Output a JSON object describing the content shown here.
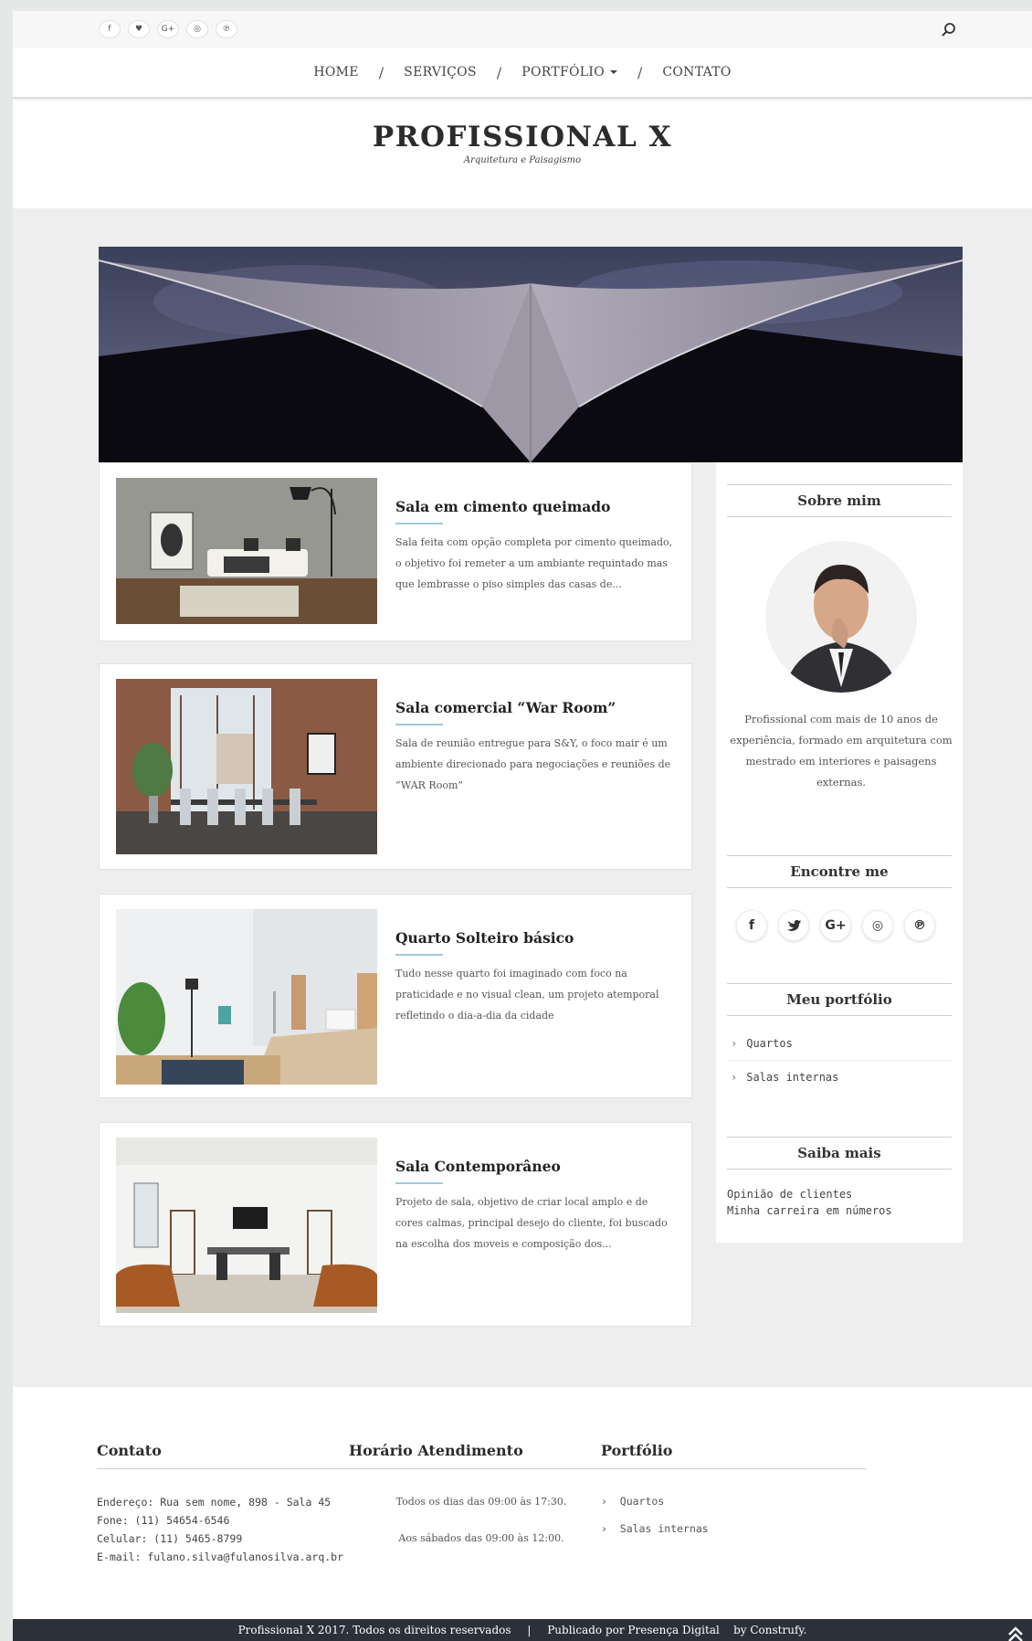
{
  "topbar": {
    "social": [
      {
        "icon": "facebook-icon",
        "glyph": "f"
      },
      {
        "icon": "twitter-icon",
        "glyph": "♥"
      },
      {
        "icon": "google-plus-icon",
        "glyph": "G+"
      },
      {
        "icon": "instagram-icon",
        "glyph": "◎"
      },
      {
        "icon": "pinterest-icon",
        "glyph": "℗"
      }
    ]
  },
  "nav": {
    "items": [
      "HOME",
      "SERVIÇOS",
      "PORTFÓLIO",
      "CONTATO"
    ],
    "separator": "/"
  },
  "brand": {
    "title": "PROFISSIONAL X",
    "tagline": "Arquitetura e Paisagismo"
  },
  "posts": [
    {
      "title": "Sala em cimento queimado",
      "excerpt": "Sala feita com opção completa por cimento queimado, o objetivo foi remeter a um ambiante requintado mas que lembrasse o piso simples das casas de..."
    },
    {
      "title": "Sala comercial “War Room”",
      "excerpt": "Sala de reunião entregue para S&Y, o foco mair é um ambiente direcionado para negociações e reuniões de “WAR Room”"
    },
    {
      "title": "Quarto Solteiro básico",
      "excerpt": "Tudo nesse quarto foi imaginado com foco na praticidade e no visual clean, um projeto atemporal refletindo o dia-a-dia da cidade"
    },
    {
      "title": "Sala Contemporâneo",
      "excerpt": "Projeto de sala, objetivo de criar local amplo e de cores calmas, principal desejo do cliente, foi buscado na escolha dos moveis e composição dos..."
    }
  ],
  "sidebar": {
    "about_title": "Sobre mim",
    "about_text": "Profissional com mais de 10 anos de experiência, formado em arquitetura com mestrado em interiores e paisagens externas.",
    "find_title": "Encontre me",
    "social": [
      {
        "icon": "facebook-icon",
        "glyph": "f"
      },
      {
        "icon": "twitter-icon",
        "glyph": "🐦"
      },
      {
        "icon": "google-plus-icon",
        "glyph": "G+"
      },
      {
        "icon": "instagram-icon",
        "glyph": "◎"
      },
      {
        "icon": "pinterest-icon",
        "glyph": "℗"
      }
    ],
    "portfolio_title": "Meu portfólio",
    "portfolio_items": [
      "Quartos",
      "Salas internas"
    ],
    "more_title": "Saiba mais",
    "more_items": [
      "Opinião de clientes",
      "Minha carreira em números"
    ]
  },
  "footer": {
    "contact_title": "Contato",
    "contact_lines": [
      "Endereço: Rua sem nome, 898 - Sala 45",
      "Fone: (11) 54654-6546",
      "Celular: (11) 5465-8799",
      "E-mail: fulano.silva@fulanosilva.arq.br"
    ],
    "hours_title": "Horário Atendimento",
    "hours_lines": [
      "Todos os dias das 09:00 às 17:30.",
      "Aos sábados das 09:00 às 12:00."
    ],
    "portfolio_title": "Portfólio",
    "portfolio_items": [
      "Quartos",
      "Salas internas"
    ]
  },
  "copyright": {
    "left": "Profissional X 2017. Todos os direitos reservados",
    "sep": "|",
    "right": "Publicado por Presença Digital",
    "credit": "by Construfy."
  },
  "colors": {
    "accent_underline": "#9fc9dd",
    "footer_bar": "#2a3138",
    "page_bg": "#eeeeee"
  }
}
